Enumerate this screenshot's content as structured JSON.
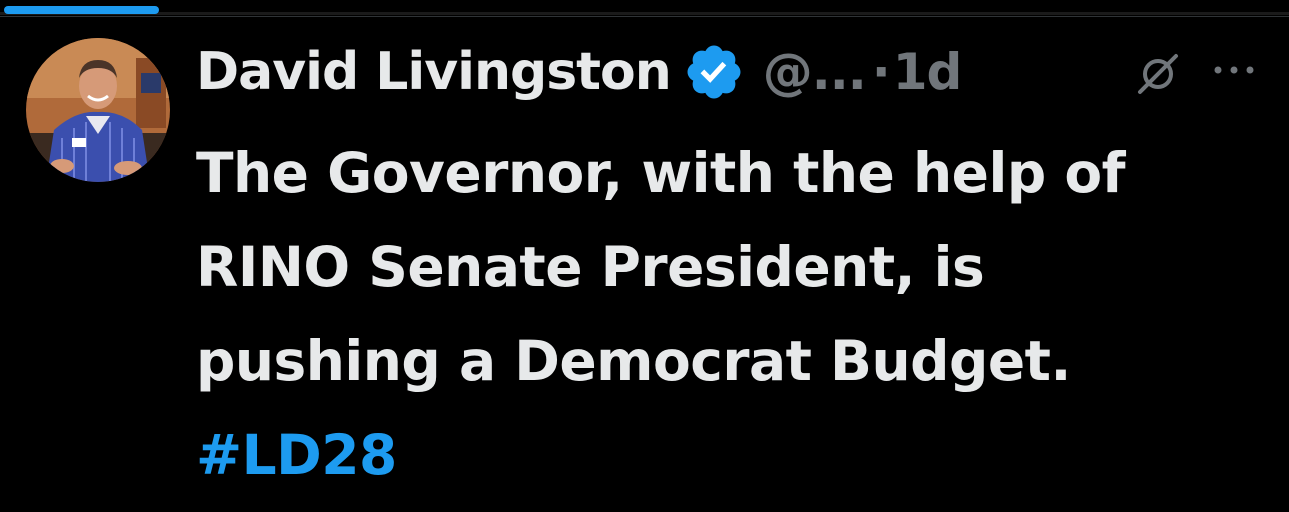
{
  "progress": {
    "fraction": 0.12
  },
  "author": {
    "name": "David Livingston",
    "verified": true,
    "handle": "@...",
    "separator": "·",
    "time": "1d"
  },
  "tweet": {
    "lines": [
      "The Governor, with the help of",
      "RINO Senate President, is",
      "pushing a Democrat Budget."
    ],
    "hashtag": "#LD28"
  },
  "icons": {
    "verified": "verified-badge-icon",
    "grok": "grok-icon",
    "more": "more-options-icon"
  },
  "colors": {
    "background": "#000000",
    "text": "#e7e9ea",
    "secondary": "#71767b",
    "accent": "#1d9bf0"
  }
}
